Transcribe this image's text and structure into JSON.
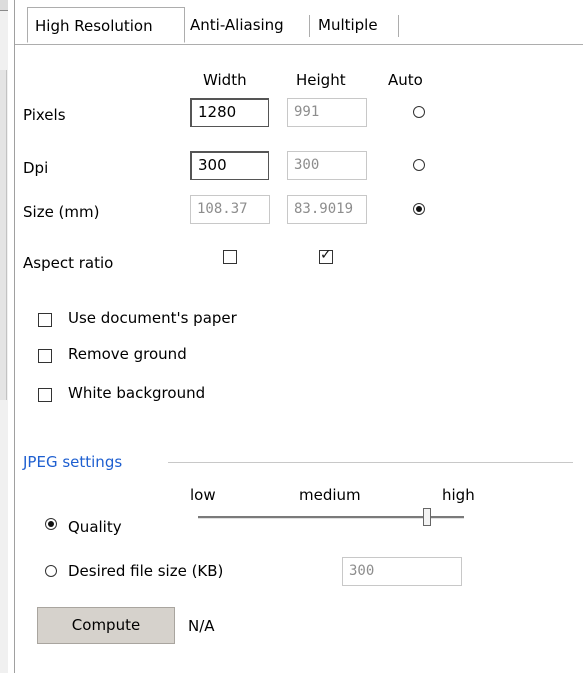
{
  "tabs": [
    {
      "label": "High Resolution",
      "active": true
    },
    {
      "label": "Anti-Aliasing",
      "active": false
    },
    {
      "label": "Multiple",
      "active": false
    }
  ],
  "columns": {
    "width": "Width",
    "height": "Height",
    "auto": "Auto"
  },
  "rows": {
    "pixels": {
      "label": "Pixels",
      "width": "1280",
      "height": "991",
      "auto_selected": false
    },
    "dpi": {
      "label": "Dpi",
      "width": "300",
      "height": "300",
      "auto_selected": false
    },
    "size": {
      "label": "Size (mm)",
      "width": "108.37",
      "height": "83.9019",
      "auto_selected": true
    }
  },
  "aspect_ratio": {
    "label": "Aspect ratio",
    "width_checked": false,
    "height_checked": true
  },
  "options": {
    "use_document_paper": {
      "label": "Use document's paper",
      "checked": false
    },
    "remove_ground": {
      "label": "Remove ground",
      "checked": false
    },
    "white_background": {
      "label": "White background",
      "checked": false
    }
  },
  "jpeg": {
    "group_label": "JPEG settings",
    "scale_low": "low",
    "scale_medium": "medium",
    "scale_high": "high",
    "quality_label": "Quality",
    "quality_selected": true,
    "quality_level": 0.85,
    "file_size_label": "Desired file size (KB)",
    "file_size_selected": false,
    "file_size_value": "300"
  },
  "compute": {
    "button_label": "Compute",
    "result": "N/A"
  },
  "colors": {
    "group_label": "#1e5fd0",
    "button_bg": "#d6d2cc",
    "disabled_text": "#8d8d8d"
  }
}
